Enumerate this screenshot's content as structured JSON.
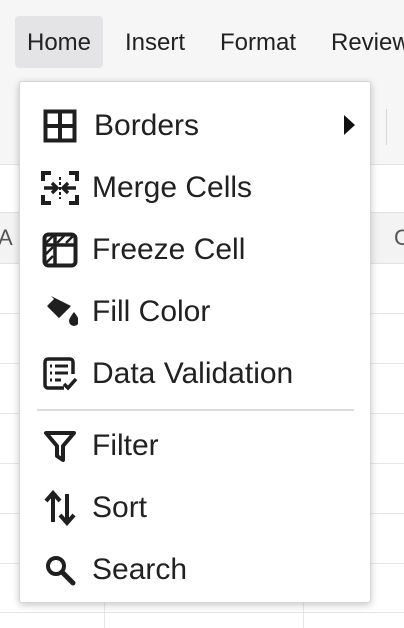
{
  "menubar": {
    "tabs": [
      {
        "label": "Home",
        "active": true
      },
      {
        "label": "Insert"
      },
      {
        "label": "Format"
      },
      {
        "label": "Review"
      }
    ]
  },
  "grid": {
    "column_letters": [
      "A",
      "C"
    ]
  },
  "dropdown": {
    "items": [
      {
        "label": "Borders",
        "icon": "borders-icon",
        "has_submenu": true
      },
      {
        "label": "Merge Cells",
        "icon": "merge-cells-icon"
      },
      {
        "label": "Freeze Cell",
        "icon": "freeze-cell-icon"
      },
      {
        "label": "Fill Color",
        "icon": "fill-color-icon"
      },
      {
        "label": "Data Validation",
        "icon": "data-validation-icon"
      },
      {
        "label": "Filter",
        "icon": "filter-icon"
      },
      {
        "label": "Sort",
        "icon": "sort-icon"
      },
      {
        "label": "Search",
        "icon": "search-icon"
      }
    ]
  },
  "colors": {
    "menubar_bg": "#f6f6f7",
    "active_tab_bg": "#e4e4e6",
    "text": "#212121",
    "icon": "#1f1f1f"
  }
}
